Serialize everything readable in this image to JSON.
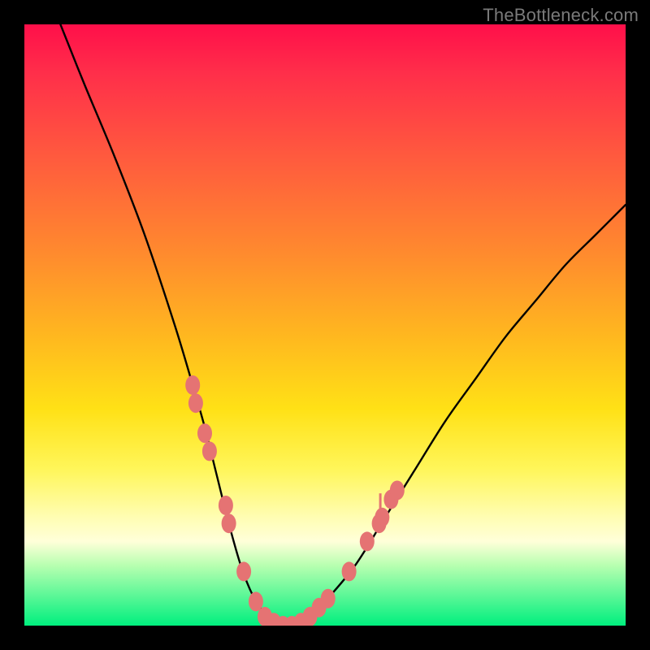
{
  "watermark": "TheBottleneck.com",
  "chart_data": {
    "type": "line",
    "title": "",
    "xlabel": "",
    "ylabel": "",
    "xlim": [
      0,
      100
    ],
    "ylim": [
      0,
      100
    ],
    "curve": {
      "name": "bottleneck-curve",
      "x": [
        6,
        10,
        15,
        20,
        25,
        28,
        30,
        32,
        34,
        36,
        38,
        40,
        42,
        44,
        46,
        48,
        50,
        55,
        60,
        65,
        70,
        75,
        80,
        85,
        90,
        95,
        100
      ],
      "y": [
        100,
        90,
        78,
        65,
        50,
        40,
        33,
        25,
        17,
        10,
        5,
        2,
        0,
        0,
        0,
        2,
        4,
        10,
        18,
        26,
        34,
        41,
        48,
        54,
        60,
        65,
        70
      ]
    },
    "markers": {
      "name": "highlight-dots",
      "color": "#e57373",
      "points": [
        {
          "x": 28.0,
          "y": 40
        },
        {
          "x": 28.5,
          "y": 37
        },
        {
          "x": 30.0,
          "y": 32
        },
        {
          "x": 30.8,
          "y": 29
        },
        {
          "x": 33.5,
          "y": 20
        },
        {
          "x": 34.0,
          "y": 17
        },
        {
          "x": 36.5,
          "y": 9
        },
        {
          "x": 38.5,
          "y": 4
        },
        {
          "x": 40.0,
          "y": 1.5
        },
        {
          "x": 41.5,
          "y": 0.5
        },
        {
          "x": 43.0,
          "y": 0
        },
        {
          "x": 44.5,
          "y": 0
        },
        {
          "x": 46.0,
          "y": 0.5
        },
        {
          "x": 47.5,
          "y": 1.5
        },
        {
          "x": 49.0,
          "y": 3
        },
        {
          "x": 50.5,
          "y": 4.5
        },
        {
          "x": 54.0,
          "y": 9
        },
        {
          "x": 57.0,
          "y": 14
        },
        {
          "x": 59.0,
          "y": 17
        },
        {
          "x": 59.5,
          "y": 18
        },
        {
          "x": 61.0,
          "y": 21
        },
        {
          "x": 62.0,
          "y": 22.5
        }
      ]
    },
    "spike": {
      "x": 59.2,
      "y_from": 17,
      "y_to": 22
    }
  }
}
